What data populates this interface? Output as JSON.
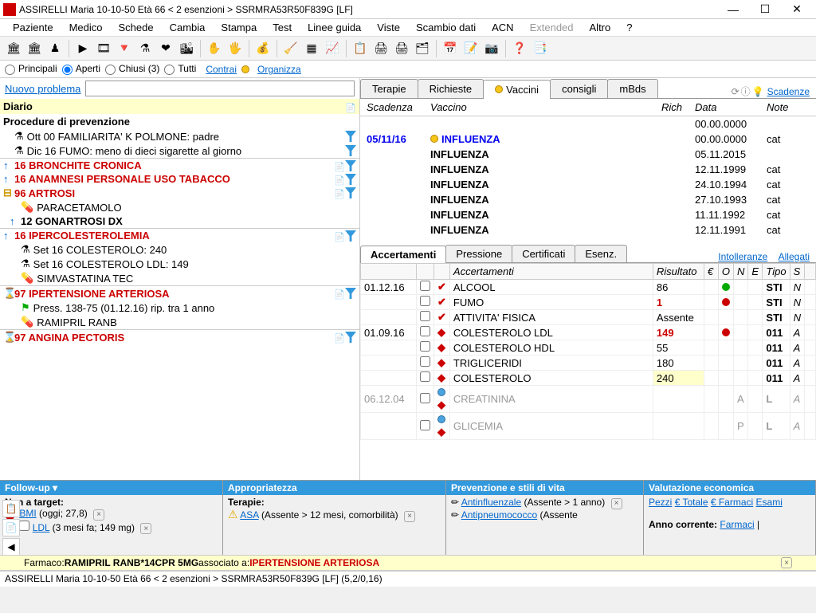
{
  "title": "ASSIRELLI Maria  10-10-50  Età 66  < 2 esenzioni >  SSRMRA53R50F839G  [LF]",
  "menu": [
    "Paziente",
    "Medico",
    "Schede",
    "Cambia",
    "Stampa",
    "Test",
    "Linee guida",
    "Viste",
    "Scambio dati",
    "ACN",
    "Extended",
    "Altro",
    "?"
  ],
  "menu_disabled": [
    "Extended"
  ],
  "filters": {
    "principali": "Principali",
    "aperti": "Aperti",
    "chiusi": "Chiusi (3)",
    "tutti": "Tutti",
    "contrai": "Contrai",
    "organizza": "Organizza"
  },
  "newprob_label": "Nuovo problema",
  "diario": "Diario",
  "procedure_hdr": "Procedure di prevenzione",
  "prob_items": [
    {
      "txt": "Ott 00 FAMILIARITA' K POLMONE: padre",
      "icon": "flask"
    },
    {
      "txt": "Dic 16 FUMO: meno di dieci sigarette al giorno",
      "icon": "flask"
    }
  ],
  "problems": [
    {
      "arrow": "↑",
      "label": "16 BRONCHITE CRONICA",
      "red": true,
      "icons": [
        "doc",
        "funnel"
      ]
    },
    {
      "arrow": "↑",
      "label": "16 ANAMNESI PERSONALE USO TABACCO",
      "red": true,
      "icons": [
        "doc",
        "funnel"
      ]
    },
    {
      "arrow": "□",
      "label": "96 ARTROSI",
      "red": true,
      "icons": [
        "doc",
        "funnel"
      ],
      "children": [
        {
          "txt": "PARACETAMOLO",
          "icon": "pill"
        },
        {
          "arrow": "↑",
          "txt": "12 GONARTROSI DX",
          "bold": true
        }
      ]
    },
    {
      "arrow": "↑",
      "label": "16 IPERCOLESTEROLEMIA",
      "red": true,
      "icons": [
        "doc",
        "funnel"
      ],
      "children": [
        {
          "txt": "Set 16 COLESTEROLO: 240",
          "icon": "flask"
        },
        {
          "txt": "Set 16 COLESTEROLO LDL: 149",
          "icon": "flask"
        },
        {
          "txt": "SIMVASTATINA TEC",
          "icon": "pill"
        }
      ]
    },
    {
      "arrow": "⌛",
      "label": "97 IPERTENSIONE ARTERIOSA",
      "red": true,
      "icons": [
        "doc",
        "funnel"
      ],
      "children": [
        {
          "txt": "Press. 138-75 (01.12.16) rip. tra 1 anno",
          "icon": "flag"
        },
        {
          "txt": "RAMIPRIL RANB",
          "icon": "pill"
        }
      ]
    },
    {
      "arrow": "⌛",
      "label": "97 ANGINA PECTORIS",
      "red": true,
      "icons": [
        "doc",
        "funnel"
      ]
    }
  ],
  "tabs": [
    "Terapie",
    "Richieste",
    "Vaccini",
    "consigli",
    "mBds"
  ],
  "tabs_active": "Vaccini",
  "scadenze_link": "Scadenze",
  "vacc_headers": [
    "Scadenza",
    "Vaccino",
    "Rich",
    "Data",
    "Note"
  ],
  "vacc_rows": [
    {
      "scad": "",
      "vacc": "",
      "rich": "",
      "data": "00.00.0000",
      "note": ""
    },
    {
      "scad": "05/11/16",
      "vacc": "INFLUENZA",
      "rich": "",
      "data": "00.00.0000",
      "note": "cat",
      "hi": true
    },
    {
      "scad": "",
      "vacc": "INFLUENZA",
      "rich": "",
      "data": "05.11.2015",
      "note": ""
    },
    {
      "scad": "",
      "vacc": "INFLUENZA",
      "rich": "",
      "data": "12.11.1999",
      "note": "cat"
    },
    {
      "scad": "",
      "vacc": "INFLUENZA",
      "rich": "",
      "data": "24.10.1994",
      "note": "cat"
    },
    {
      "scad": "",
      "vacc": "INFLUENZA",
      "rich": "",
      "data": "27.10.1993",
      "note": "cat"
    },
    {
      "scad": "",
      "vacc": "INFLUENZA",
      "rich": "",
      "data": "11.11.1992",
      "note": "cat"
    },
    {
      "scad": "",
      "vacc": "INFLUENZA",
      "rich": "",
      "data": "12.11.1991",
      "note": "cat"
    }
  ],
  "subtabs": [
    "Accertamenti",
    "Pressione",
    "Certificati",
    "Esenz."
  ],
  "subtabs_active": "Accertamenti",
  "intolleranze": "Intolleranze",
  "allegati": "Allegati",
  "acc_headers": [
    "",
    "",
    "",
    "Accertamenti",
    "Risultato",
    "€",
    "O",
    "N",
    "E",
    "Tipo",
    "S",
    ""
  ],
  "acc_rows": [
    {
      "date": "01.12.16",
      "mark": "✔",
      "name": "ALCOOL",
      "res": "86",
      "dot": "green",
      "tipo": "STI",
      "s": "N"
    },
    {
      "date": "",
      "mark": "✔",
      "name": "FUMO",
      "res": "1",
      "resred": true,
      "dot": "red",
      "tipo": "STI",
      "s": "N"
    },
    {
      "date": "",
      "mark": "✔",
      "name": "ATTIVITA' FISICA",
      "res": "Assente",
      "tipo": "STI",
      "s": "N"
    },
    {
      "date": "01.09.16",
      "mark": "◆",
      "name": "COLESTEROLO LDL",
      "res": "149",
      "resred": true,
      "dot": "red",
      "tipo": "011",
      "s": "A"
    },
    {
      "date": "",
      "mark": "◆",
      "name": "COLESTEROLO HDL",
      "res": "55",
      "tipo": "011",
      "s": "A"
    },
    {
      "date": "",
      "mark": "◆",
      "name": "TRIGLICERIDI",
      "res": "180",
      "tipo": "011",
      "s": "A"
    },
    {
      "date": "",
      "mark": "◆",
      "name": "COLESTEROLO",
      "res": "240",
      "yellow": true,
      "tipo": "011",
      "s": "A"
    },
    {
      "date": "06.12.04",
      "mark": "◆",
      "name": "CREATININA",
      "res": "",
      "gray": true,
      "n": "A",
      "tipo": "L",
      "s": "A",
      "bluedot": true
    },
    {
      "date": "",
      "mark": "◆",
      "name": "GLICEMIA",
      "res": "",
      "gray": true,
      "n": "P",
      "tipo": "L",
      "s": "A",
      "bluedot": true
    }
  ],
  "bpanels": {
    "followup": {
      "title": "Follow-up  ▾",
      "nontarget": "Non a target:",
      "bmi": "BMI",
      "bmi_detail": "(oggi; 27,8)",
      "ldl": "LDL",
      "ldl_detail": "(3 mesi fa; 149 mg)"
    },
    "appropr": {
      "title": "Appropriatezza",
      "terapie": "Terapie:",
      "asa": "ASA",
      "asa_detail": "(Assente > 12 mesi, comorbilità)"
    },
    "prevenzione": {
      "title": "Prevenzione e stili di vita",
      "antiinf": "Antinfluenzale",
      "antiinf_detail": "(Assente > 1 anno)",
      "antipneu": "Antipneumococco",
      "antipneu_detail": "(Assente"
    },
    "valutazione": {
      "title": "Valutazione economica",
      "pezzi": "Pezzi",
      "etotale": "€ Totale",
      "efarmaci": "€ Farmaci",
      "esami": "Esami",
      "anno": "Anno corrente:",
      "farmaci": "Farmaci"
    }
  },
  "farmaco": {
    "pre": "Farmaco: ",
    "drug": "RAMIPRIL RANB*14CPR 5MG",
    "assoc": " associato a: ",
    "cond": "IPERTENSIONE ARTERIOSA"
  },
  "statusbar": "ASSIRELLI Maria  10-10-50  Età 66  < 2 esenzioni >  SSRMRA53R50F839G  [LF]   (5,2/0,16)"
}
